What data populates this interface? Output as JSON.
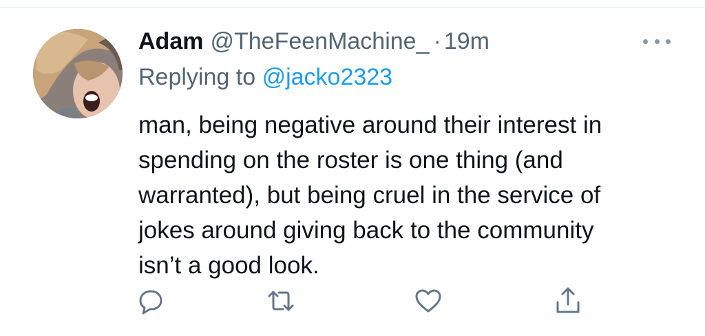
{
  "tweet": {
    "display_name": "Adam",
    "handle": "@TheFeenMachine_",
    "separator": "·",
    "timestamp": "19m",
    "replying_prefix": "Replying to",
    "replying_to": "@jacko2323",
    "text_lines": [
      "man, being negative around their interest in",
      "spending on the roster is one thing (and",
      "warranted), but being cruel in the service of",
      "jokes around giving back to the community",
      "isn’t a good look."
    ]
  },
  "icons": {
    "more": "more-horizontal-icon",
    "reply": "comment-bubble-icon",
    "retweet": "retweet-arrows-icon",
    "like": "heart-outline-icon",
    "share": "share-upload-icon"
  },
  "colors": {
    "text": "#0f1419",
    "secondary": "#536471",
    "link": "#1d9bf0",
    "icon": "#657786"
  }
}
